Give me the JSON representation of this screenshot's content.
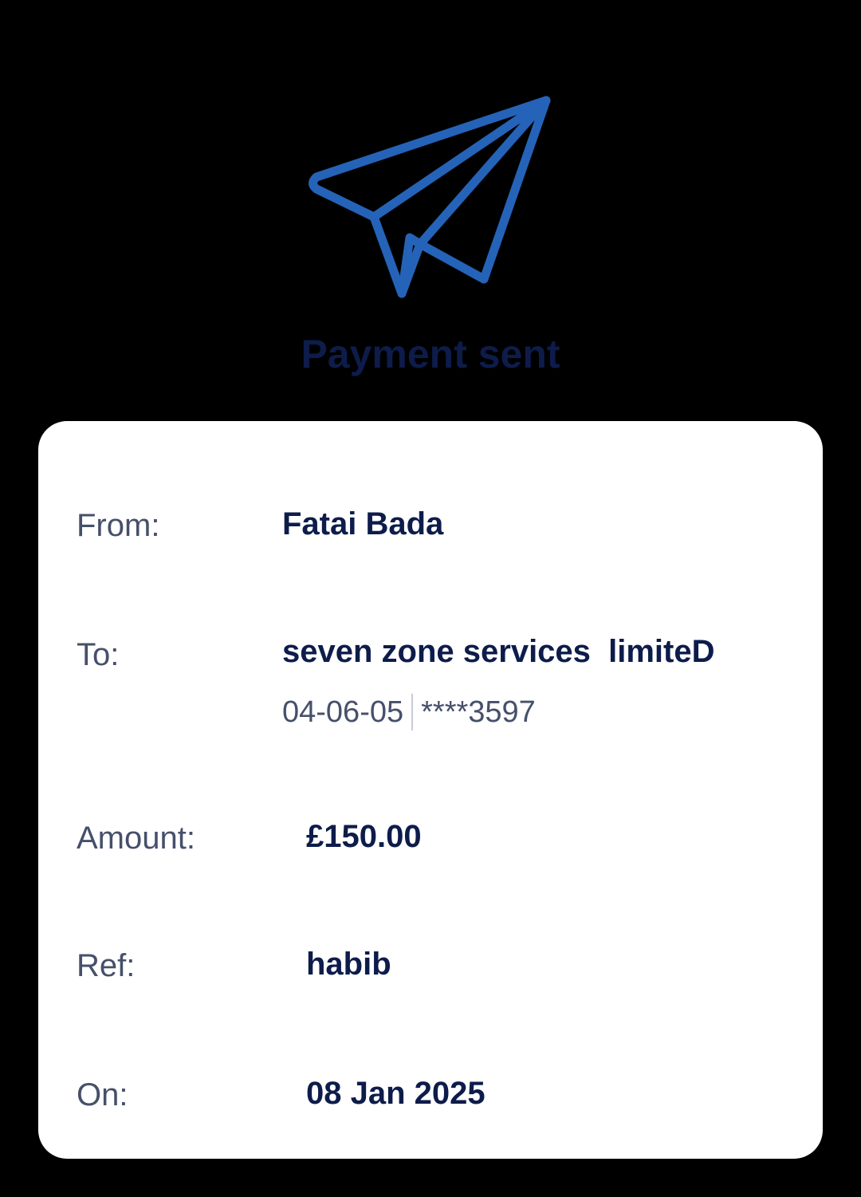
{
  "header": {
    "icon": "paper-plane-icon",
    "title": "Payment sent",
    "icon_color": "#2563b8"
  },
  "details": {
    "from": {
      "label": "From:",
      "value": "Fatai Bada"
    },
    "to": {
      "label": "To:",
      "value": "seven zone services  limiteD",
      "sort_code": "04-06-05",
      "account_masked": "****3597"
    },
    "amount": {
      "label": "Amount:",
      "value": "£150.00"
    },
    "ref": {
      "label": "Ref:",
      "value": "habib"
    },
    "on": {
      "label": "On:",
      "value": "08 Jan 2025"
    }
  }
}
